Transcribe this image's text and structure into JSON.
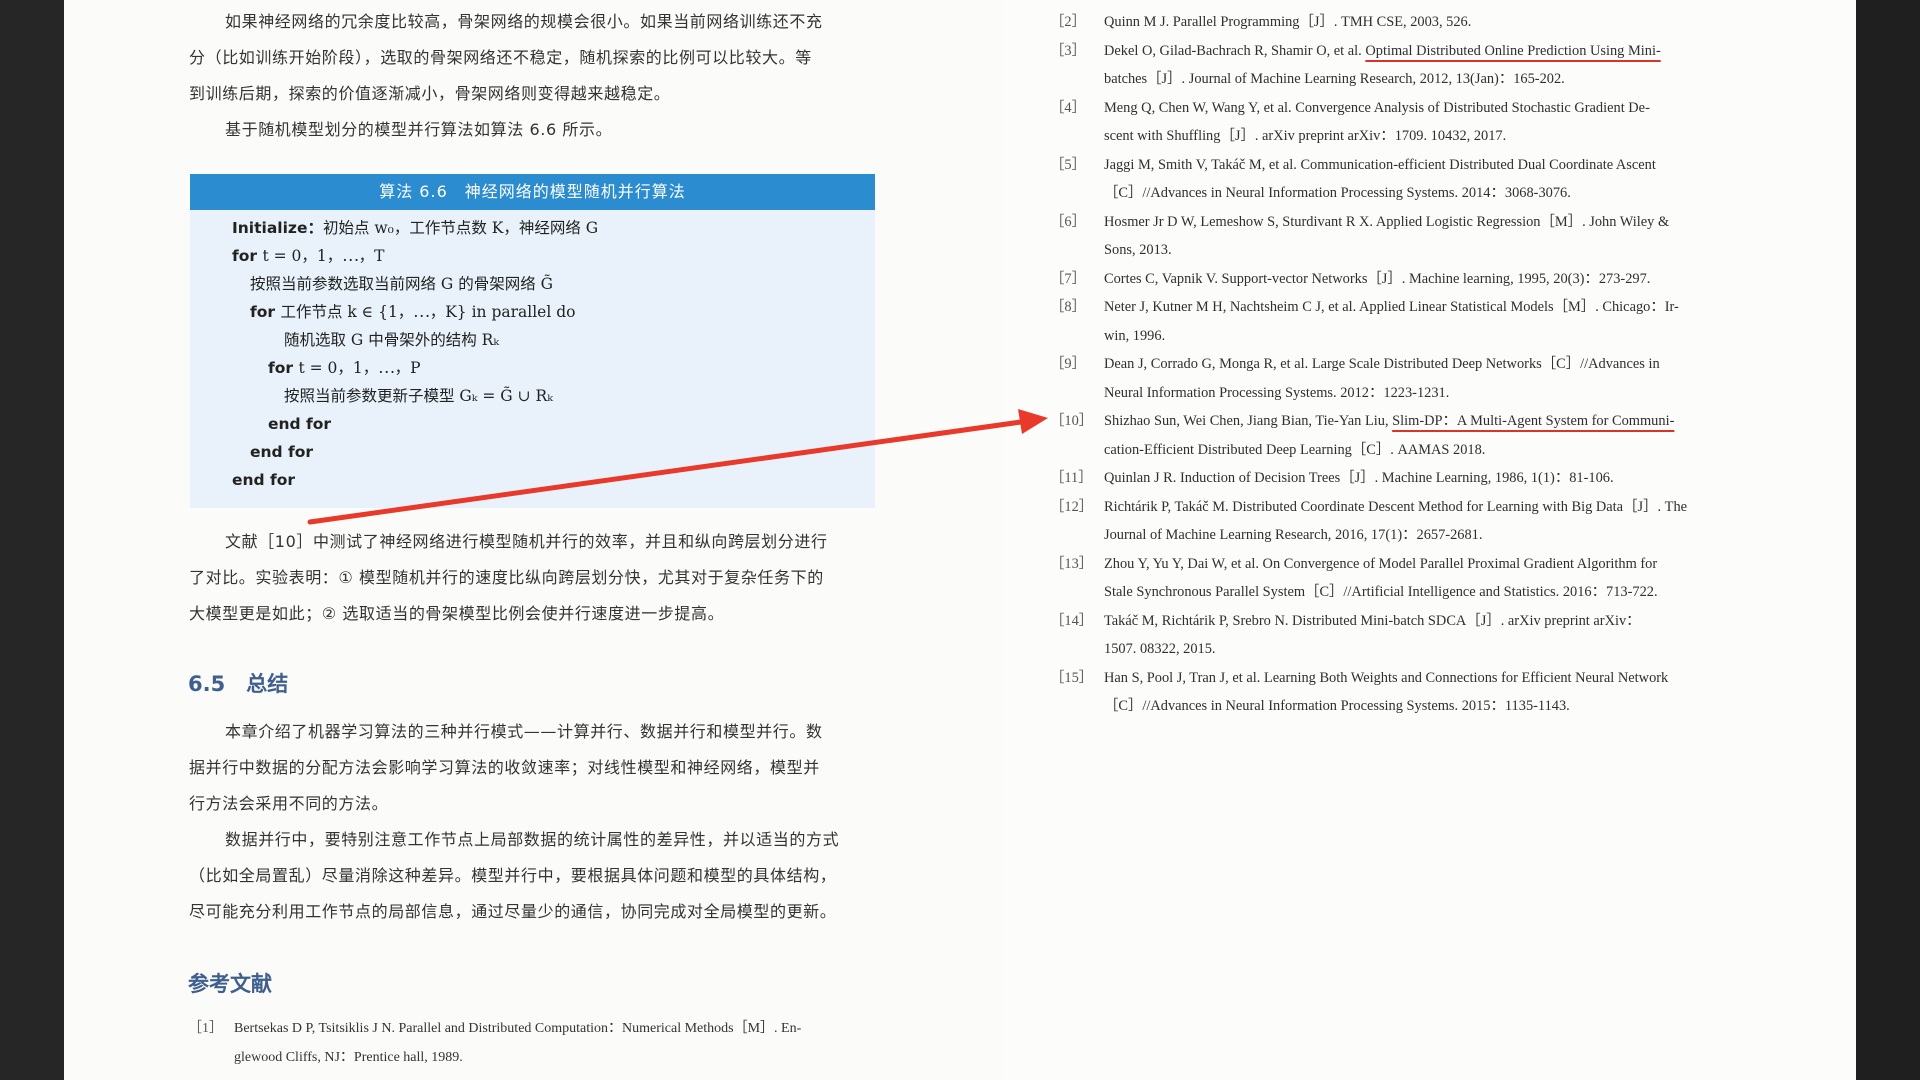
{
  "left_page": {
    "intro_lines": [
      "如果神经网络的冗余度比较高，骨架网络的规模会很小。如果当前网络训练还不充",
      "分（比如训练开始阶段），选取的骨架网络还不稳定，随机探索的比例可以比较大。等",
      "到训练后期，探索的价值逐渐减小，骨架网络则变得越来越稳定。",
      "基于随机模型划分的模型并行算法如算法 6.6 所示。"
    ],
    "algorithm": {
      "title": "算法 6.6　神经网络的模型随机并行算法",
      "lines": [
        {
          "kw": "Initialize：",
          "text": "初始点 w₀，工作节点数 K，神经网络 G"
        },
        {
          "kw": "for ",
          "text": "t = 0，1，⋯，T"
        },
        {
          "kw": "",
          "text": "按照当前参数选取当前网络 G 的骨架网络 G̃"
        },
        {
          "kw": "for ",
          "text": "工作节点 k ∈ {1，⋯，K} in parallel do"
        },
        {
          "kw": "",
          "text": "随机选取 G 中骨架外的结构 Rₖ"
        },
        {
          "kw": "for ",
          "text": "t = 0，1，⋯，P"
        },
        {
          "kw": "",
          "text": "按照当前参数更新子模型 Gₖ = G̃ ∪ Rₖ"
        },
        {
          "kw": "end for",
          "text": ""
        },
        {
          "kw": "end for",
          "text": ""
        },
        {
          "kw": "end for",
          "text": ""
        }
      ]
    },
    "experiment_lines": [
      "文献［10］中测试了神经网络进行模型随机并行的效率，并且和纵向跨层划分进行",
      "了对比。实验表明：① 模型随机并行的速度比纵向跨层划分快，尤其对于复杂任务下的",
      "大模型更是如此；② 选取适当的骨架模型比例会使并行速度进一步提高。"
    ],
    "section_title": "6.5　总结",
    "summary_lines": [
      "本章介绍了机器学习算法的三种并行模式——计算并行、数据并行和模型并行。数",
      "据并行中数据的分配方法会影响学习算法的收敛速率；对线性模型和神经网络，模型并",
      "行方法会采用不同的方法。",
      "数据并行中，要特别注意工作节点上局部数据的统计属性的差异性，并以适当的方式",
      "（比如全局置乱）尽量消除这种差异。模型并行中，要根据具体问题和模型的具体结构，",
      "尽可能充分利用工作节点的局部信息，通过尽量少的通信，协同完成对全局模型的更新。"
    ],
    "refs_title": "参考文献",
    "ref1_num": "［1］",
    "ref1_line1": "Bertsekas D P, Tsitsiklis J N. Parallel and Distributed Computation：Numerical Methods［M］. En-",
    "ref1_line2": "glewood Cliffs, NJ：Prentice hall, 1989."
  },
  "right_page": {
    "references": [
      {
        "num": "［2］",
        "lines": [
          "Quinn M J. Parallel Programming［J］. TMH CSE, 2003, 526."
        ]
      },
      {
        "num": "［3］",
        "lines": [
          "Dekel O, Gilad-Bachrach R, Shamir O, et al. Optimal Distributed Online Prediction Using Mini-",
          "batches［J］. Journal of Machine Learning Research, 2012, 13(Jan)：165-202."
        ]
      },
      {
        "num": "［4］",
        "lines": [
          "Meng Q, Chen W, Wang Y, et al. Convergence Analysis of Distributed Stochastic Gradient De-",
          "scent with Shuffling［J］. arXiv preprint arXiv：1709. 10432, 2017."
        ]
      },
      {
        "num": "［5］",
        "lines": [
          "Jaggi M, Smith V, Takáč M, et al. Communication-efficient Distributed Dual Coordinate Ascent",
          "［C］//Advances in Neural Information Processing Systems. 2014：3068-3076."
        ]
      },
      {
        "num": "［6］",
        "lines": [
          "Hosmer Jr D W, Lemeshow S, Sturdivant R X. Applied Logistic Regression［M］. John Wiley &",
          "Sons, 2013."
        ]
      },
      {
        "num": "［7］",
        "lines": [
          "Cortes C, Vapnik V. Support-vector Networks［J］. Machine learning, 1995, 20(3)：273-297."
        ]
      },
      {
        "num": "［8］",
        "lines": [
          "Neter J, Kutner M H, Nachtsheim C J, et al. Applied Linear Statistical Models［M］. Chicago：Ir-",
          "win, 1996."
        ]
      },
      {
        "num": "［9］",
        "lines": [
          "Dean J, Corrado G, Monga R, et al. Large Scale Distributed Deep Networks［C］//Advances in",
          "Neural Information Processing Systems. 2012：1223-1231."
        ]
      },
      {
        "num": "［10］",
        "lines": [
          "Shizhao Sun, Wei Chen, Jiang Bian, Tie-Yan Liu, Slim-DP：A Multi-Agent System for Communi-",
          "cation-Efficient Distributed Deep Learning［C］. AAMAS 2018."
        ]
      },
      {
        "num": "［11］",
        "lines": [
          "Quinlan J R. Induction of Decision Trees［J］. Machine Learning, 1986, 1(1)：81-106."
        ]
      },
      {
        "num": "［12］",
        "lines": [
          "Richtárik P, Takáč M. Distributed Coordinate Descent Method for Learning with Big Data［J］. The",
          "Journal of Machine Learning Research, 2016, 17(1)：2657-2681."
        ]
      },
      {
        "num": "［13］",
        "lines": [
          "Zhou Y, Yu Y, Dai W, et al. On Convergence of Model Parallel Proximal Gradient Algorithm for",
          "Stale Synchronous Parallel System［C］//Artificial Intelligence and Statistics. 2016：713-722."
        ]
      },
      {
        "num": "［14］",
        "lines": [
          "Takáč M, Richtárik P, Srebro N. Distributed Mini-batch SDCA［J］. arXiv preprint arXiv：",
          "1507. 08322, 2015."
        ]
      },
      {
        "num": "［15］",
        "lines": [
          "Han S, Pool J, Tran J, et al. Learning Both Weights and Connections for Efficient Neural Network",
          "［C］//Advances in Neural Information Processing Systems. 2015：1135-1143."
        ]
      }
    ]
  },
  "colors": {
    "accent_blue": "#2b8ccf",
    "heading_blue": "#3f5f8f",
    "annotation_red": "#e8392a"
  }
}
